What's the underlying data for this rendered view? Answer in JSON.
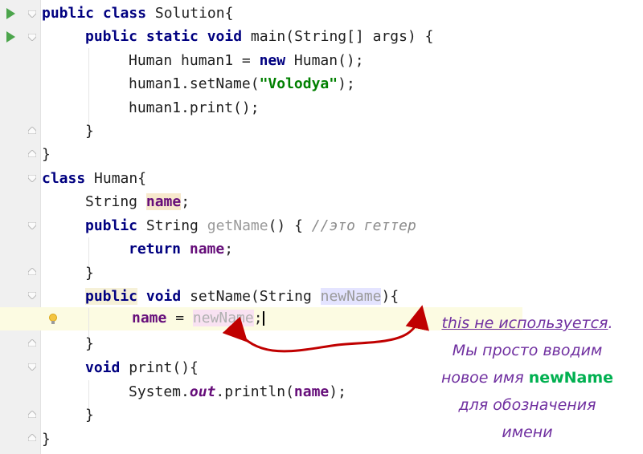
{
  "code": {
    "l1": {
      "kw": "public class",
      "rest": " Solution{"
    },
    "l2": {
      "kw": "public static void",
      "rest": " main(String[] args) {"
    },
    "l3": {
      "a": "Human human1 = ",
      "kw": "new",
      "b": " Human();"
    },
    "l4": {
      "a": "human1.setName(",
      "str": "\"Volodya\"",
      "b": ");"
    },
    "l5": "human1.print();",
    "l6": "}",
    "l7": "}",
    "l8": {
      "kw": "class",
      "rest": " Human{"
    },
    "l9": {
      "a": "String ",
      "field": "name",
      "b": ";"
    },
    "l10": {
      "kw": "public",
      "a": " String ",
      "method": "getName",
      "b": "() { ",
      "comment": "//это геттер"
    },
    "l11": {
      "kw": "return",
      "field": "name",
      "b": ";"
    },
    "l12": "}",
    "l13": {
      "kw1": "public",
      "kw2": "void",
      "a": " setName(String ",
      "param": "newName",
      "b": "){"
    },
    "l14": {
      "field": "name",
      "eq": " = ",
      "param": "newName",
      "b": ";"
    },
    "l15": "}",
    "l16": {
      "kw": "void",
      "rest": " print(){"
    },
    "l17": {
      "a": "System.",
      "out": "out",
      "b": ".println(",
      "field": "name",
      "c": ");"
    },
    "l18": "}",
    "l19": "}"
  },
  "annotation": {
    "line1": "this не используется",
    "dot": ".",
    "line2": "Мы просто вводим",
    "line3a": "новое имя ",
    "line3b": "newName",
    "line4": "для обозначения",
    "line5": "имени"
  },
  "colors": {
    "annotation": "#7030a0",
    "highlight_word": "#00b050",
    "arrow": "#c00000"
  }
}
